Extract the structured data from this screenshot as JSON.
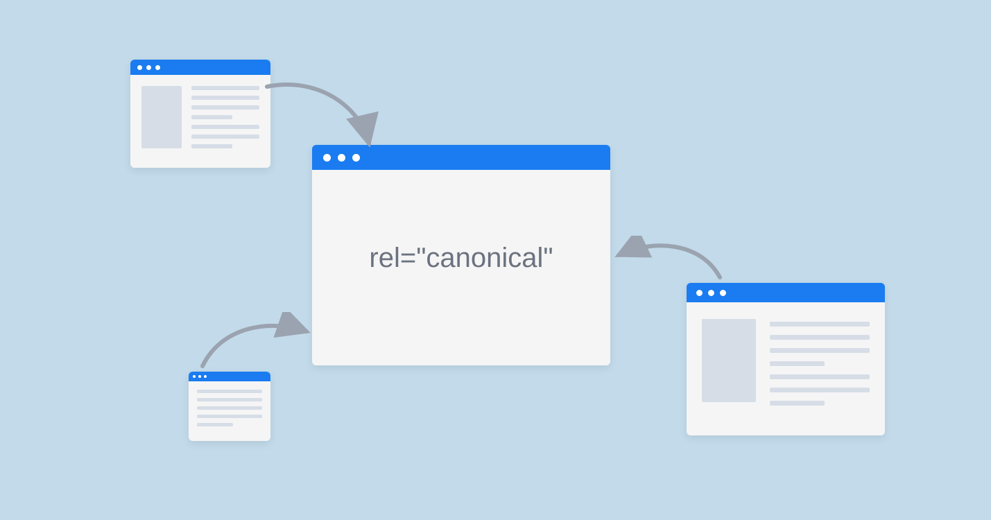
{
  "diagram": {
    "main_window_text": "rel=\"canonical\"",
    "colors": {
      "background": "#c2daea",
      "titlebar": "#1a7cf0",
      "window_bg": "#f5f5f5",
      "placeholder": "#d6dde7",
      "arrow": "#9aa3af",
      "text": "#6b7280"
    },
    "concept": "Three duplicate pages pointing via canonical link to one main page"
  }
}
